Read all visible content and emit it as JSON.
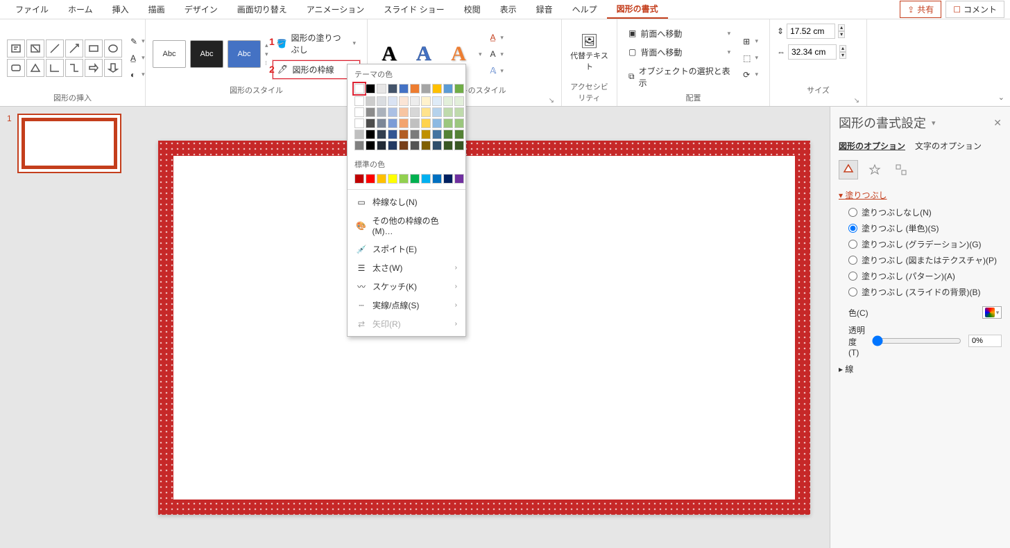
{
  "tabs": {
    "items": [
      "ファイル",
      "ホーム",
      "挿入",
      "描画",
      "デザイン",
      "画面切り替え",
      "アニメーション",
      "スライド ショー",
      "校閲",
      "表示",
      "録音",
      "ヘルプ",
      "図形の書式"
    ],
    "active_index": 12
  },
  "actions": {
    "share": "共有",
    "comment": "コメント"
  },
  "ribbon": {
    "insert_shapes_label": "図形の挿入",
    "shape_styles_label": "図形のスタイル",
    "wordart_styles_label": "ワードアートのスタイル",
    "accessibility_label": "アクセシビリティ",
    "arrange_label": "配置",
    "size_label": "サイズ",
    "style_thumbs": [
      "Abc",
      "Abc",
      "Abc"
    ],
    "shape_fill": "図形の塗りつぶし",
    "shape_outline": "図形の枠線",
    "alt_text": "代替テキスト",
    "bring_forward": "前面へ移動",
    "send_backward": "背面へ移動",
    "selection_pane": "オブジェクトの選択と表示",
    "height_value": "17.52 cm",
    "width_value": "32.34 cm"
  },
  "annotations": {
    "one": "1",
    "two": "2"
  },
  "dropdown": {
    "theme_colors_label": "テーマの色",
    "standard_colors_label": "標準の色",
    "theme_row": [
      "#ffffff",
      "#000000",
      "#44546a",
      "#4472c4",
      "#ed7d31",
      "#a5a5a5",
      "#ffc000",
      "#5b9bd5",
      "#70ad47",
      "#70ad47"
    ],
    "standard_row": [
      "#c00000",
      "#ff0000",
      "#ffc000",
      "#ffff00",
      "#92d050",
      "#00b050",
      "#00b0f0",
      "#0070c0",
      "#002060",
      "#7030a0"
    ],
    "no_outline": "枠線なし(N)",
    "more_colors": "その他の枠線の色(M)…",
    "eyedropper": "スポイト(E)",
    "weight": "太さ(W)",
    "sketch": "スケッチ(K)",
    "dashes": "実線/点線(S)",
    "arrows": "矢印(R)"
  },
  "slide_panel": {
    "slide_number": "1"
  },
  "format_pane": {
    "title": "図形の書式設定",
    "tab_shape": "図形のオプション",
    "tab_text": "文字のオプション",
    "section_fill": "塗りつぶし",
    "section_line": "線",
    "fill_options": {
      "none": "塗りつぶしなし(N)",
      "solid": "塗りつぶし (単色)(S)",
      "gradient": "塗りつぶし (グラデーション)(G)",
      "picture": "塗りつぶし (図またはテクスチャ)(P)",
      "pattern": "塗りつぶし (パターン)(A)",
      "slide_bg": "塗りつぶし (スライドの背景)(B)"
    },
    "color_label": "色(C)",
    "transparency_label": "透明度(T)",
    "transparency_value": "0%"
  }
}
